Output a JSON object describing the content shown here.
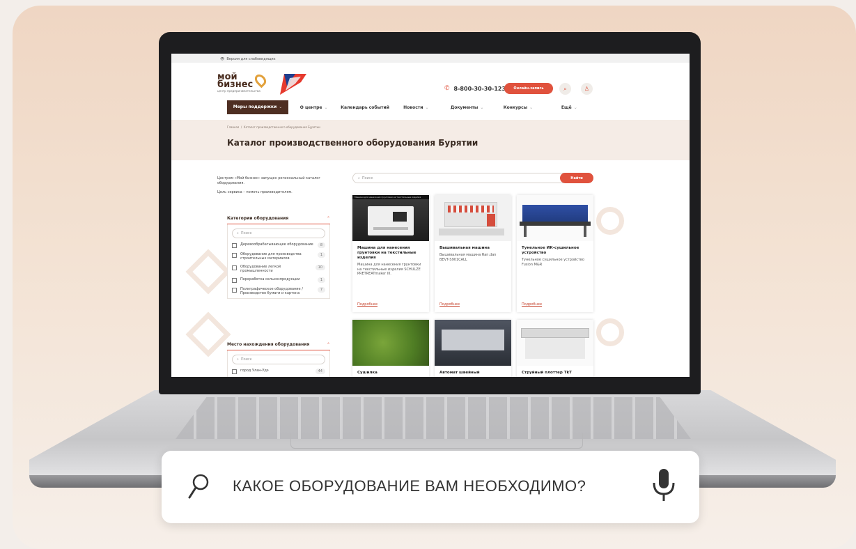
{
  "site": {
    "topbar": {
      "accessibility_label": "Версия для слабовидящих"
    },
    "logo": {
      "line1": "мой",
      "line2": "бизнес",
      "tagline": "центр предпринимательства"
    },
    "phone": "8-800-30-30-123",
    "online_button": "Онлайн-запись",
    "nav": [
      {
        "label": "Меры поддержки",
        "has_dropdown": true,
        "active": true
      },
      {
        "label": "О центре",
        "has_dropdown": true
      },
      {
        "label": "Календарь событий",
        "has_dropdown": false
      },
      {
        "label": "Новости",
        "has_dropdown": true
      },
      {
        "label": "Документы",
        "has_dropdown": true
      },
      {
        "label": "Конкурсы",
        "has_dropdown": true
      },
      {
        "label": "Ещё",
        "has_dropdown": true
      }
    ],
    "breadcrumb": {
      "home": "Главная",
      "separator": "/",
      "current": "Каталог производственного оборудования Бурятии"
    },
    "page_title": "Каталог производственного оборудования Бурятии",
    "intro": {
      "p1": "Центром «Мой бизнес» запущен региональный каталог оборудования.",
      "p2": "Цель сервиса – помочь производителям."
    },
    "search": {
      "placeholder": "Поиск",
      "button": "Найти"
    },
    "categories": {
      "title": "Категории оборудования",
      "search_placeholder": "Поиск",
      "items": [
        {
          "label": "Деревообрабатывающее оборудование",
          "count": "8"
        },
        {
          "label": "Оборудование для производства строительных материалов",
          "count": "1"
        },
        {
          "label": "Оборудование легкой промышленности",
          "count": "10"
        },
        {
          "label": "Переработка сельхозпродукции",
          "count": "1"
        },
        {
          "label": "Полиграфическое оборудование / Производство бумаги и картона",
          "count": "7"
        }
      ]
    },
    "location": {
      "title": "Место нахождения оборудования",
      "search_placeholder": "Поиск",
      "partial_item": "город Улан-Удэ",
      "partial_count": "44"
    },
    "cards": [
      {
        "title": "Машина для нанесения грунтовки на текстильные изделия",
        "desc": "Машина для нанесения грунтовки на текстильные изделия SCHULZE PRETREATmaker III.",
        "more": "Подробнее",
        "image_caption": "Машина для нанесения грунтовки на текстильные изделия"
      },
      {
        "title": "Вышивальная машина",
        "desc": "Вышивальная машина Ran.dan BEVT-S901CALL",
        "more": "Подробнее"
      },
      {
        "title": "Тунельное ИК-сушильное устройство",
        "desc": "Тунельное сушильное устройство Fusion M&R",
        "more": "Подробнее"
      },
      {
        "title": "Сушилка",
        "desc": "",
        "more": ""
      },
      {
        "title": "Автомат швейный",
        "desc": "",
        "more": ""
      },
      {
        "title": "Струйный плоттер TkT",
        "desc": "",
        "more": ""
      }
    ]
  },
  "caption": {
    "text": "КАКОЕ ОБОРУДОВАНИЕ ВАМ НЕОБХОДИМО?",
    "search_icon": "search-icon",
    "mic_icon": "microphone-icon"
  },
  "colors": {
    "accent": "#e0523d",
    "nav_active": "#4e2e22",
    "hero_bg": "#f5ece6",
    "card_bg": "#efd6c3"
  }
}
